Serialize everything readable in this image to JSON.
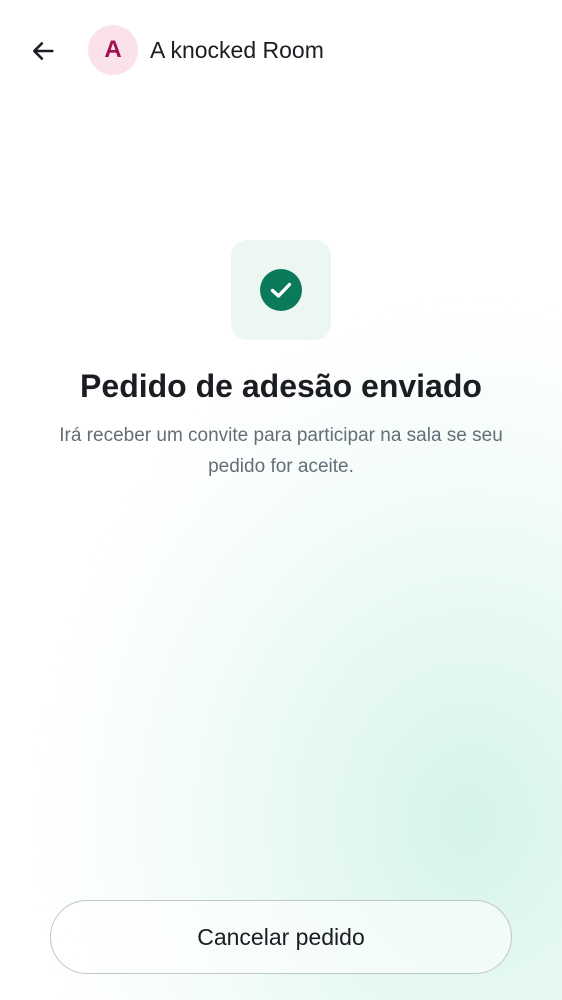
{
  "header": {
    "back_icon": "arrow-left-icon",
    "avatar_initial": "A",
    "room_name": "A knocked Room"
  },
  "status": {
    "icon": "check-circle-icon",
    "title": "Pedido de adesão enviado",
    "description": "Irá receber um convite para participar na sala se seu pedido for aceite."
  },
  "actions": {
    "cancel_label": "Cancelar pedido"
  },
  "colors": {
    "accent_green": "#0b7a5a",
    "avatar_bg": "#fbe2ea",
    "avatar_text": "#a0114e",
    "tile_bg": "#ecf7f2"
  }
}
